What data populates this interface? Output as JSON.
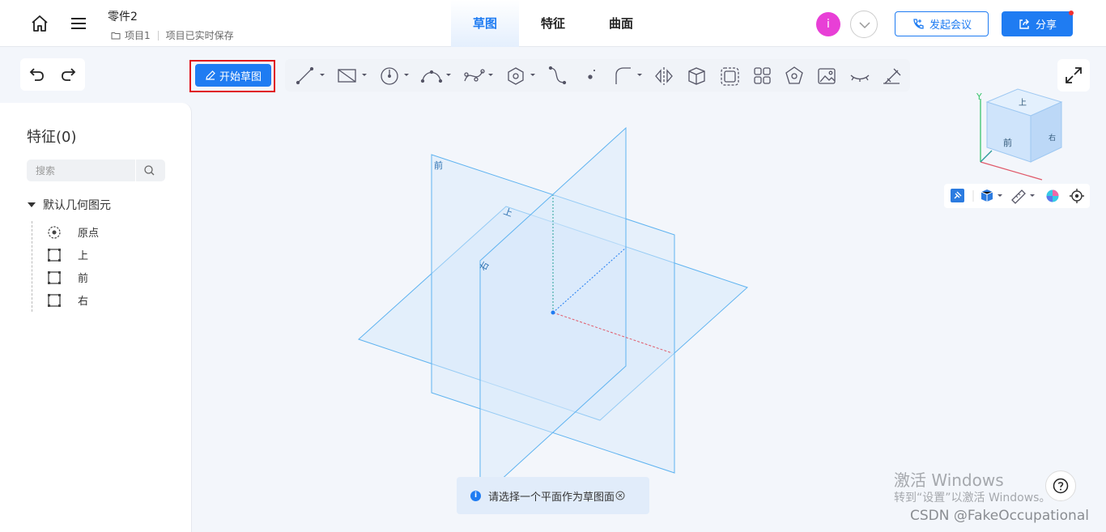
{
  "header": {
    "doc_title": "零件2",
    "project": "项目1",
    "save_status": "项目已实时保存",
    "tabs": [
      "草图",
      "特征",
      "曲面"
    ],
    "active_tab": "草图",
    "avatar_letter": "i",
    "meeting_label": "发起会议",
    "share_label": "分享"
  },
  "toolbar": {
    "start_sketch_label": "开始草图",
    "tools": [
      "line-tool",
      "rectangle-tool",
      "circle-tool",
      "arc-tool",
      "spline-tool",
      "polygon-tool",
      "curve-tool",
      "point-tool",
      "fillet-tool",
      "mirror-tool",
      "box-tool",
      "offset-tool",
      "pattern-tool",
      "shape-tool",
      "image-tool",
      "hide-tool",
      "constraint-tool"
    ]
  },
  "panel": {
    "title": "特征(0)",
    "search_placeholder": "搜索",
    "root_label": "默认几何图元",
    "items": [
      "原点",
      "上",
      "前",
      "右"
    ]
  },
  "viewport": {
    "plane_labels": {
      "front": "前",
      "top": "上",
      "right": "右"
    },
    "cube_labels": {
      "top": "上",
      "front": "前",
      "right": "右",
      "axis_y": "Y"
    }
  },
  "hint": "请选择一个平面作为草图面",
  "watermark": {
    "line1": "激活 Windows",
    "line2": "转到“设置”以激活 Windows。"
  },
  "csdn": "CSDN @FakeOccupational",
  "colors": {
    "accent": "#1f7cf2",
    "plane_fill": "#d6e9fb",
    "plane_stroke": "#5fb3f0",
    "avatar": "#e83fd6",
    "highlight": "#e0101a"
  }
}
